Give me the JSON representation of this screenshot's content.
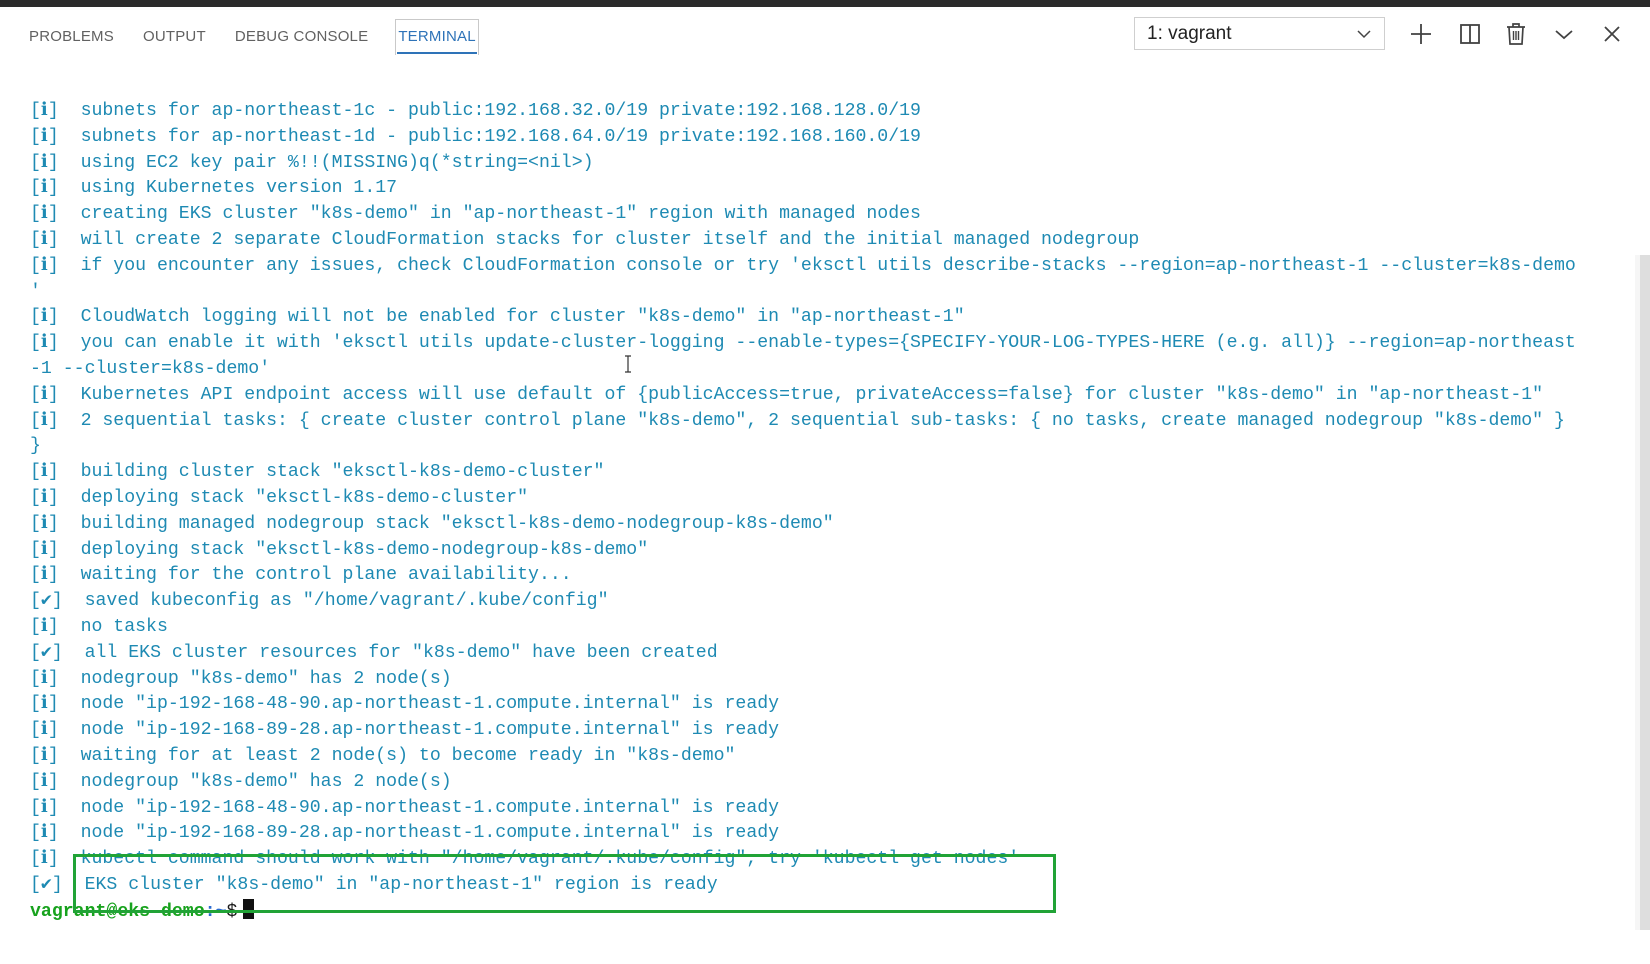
{
  "panel": {
    "tabs": [
      {
        "label": "PROBLEMS",
        "active": false
      },
      {
        "label": "OUTPUT",
        "active": false
      },
      {
        "label": "DEBUG CONSOLE",
        "active": false
      },
      {
        "label": "TERMINAL",
        "active": true
      }
    ],
    "terminal_selector": {
      "value": "1: vagrant"
    },
    "actions": [
      "plus-icon",
      "split-terminal-icon",
      "trash-icon",
      "chevron-down-icon",
      "close-icon"
    ]
  },
  "terminal": {
    "lines": [
      "[ℹ]  subnets for ap-northeast-1c - public:192.168.32.0/19 private:192.168.128.0/19",
      "[ℹ]  subnets for ap-northeast-1d - public:192.168.64.0/19 private:192.168.160.0/19",
      "[ℹ]  using EC2 key pair %!!(MISSING)q(*string=<nil>)",
      "[ℹ]  using Kubernetes version 1.17",
      "[ℹ]  creating EKS cluster \"k8s-demo\" in \"ap-northeast-1\" region with managed nodes",
      "[ℹ]  will create 2 separate CloudFormation stacks for cluster itself and the initial managed nodegroup",
      "[ℹ]  if you encounter any issues, check CloudFormation console or try 'eksctl utils describe-stacks --region=ap-northeast-1 --cluster=k8s-demo",
      "'",
      "[ℹ]  CloudWatch logging will not be enabled for cluster \"k8s-demo\" in \"ap-northeast-1\"",
      "[ℹ]  you can enable it with 'eksctl utils update-cluster-logging --enable-types={SPECIFY-YOUR-LOG-TYPES-HERE (e.g. all)} --region=ap-northeast",
      "-1 --cluster=k8s-demo'",
      "[ℹ]  Kubernetes API endpoint access will use default of {publicAccess=true, privateAccess=false} for cluster \"k8s-demo\" in \"ap-northeast-1\"",
      "[ℹ]  2 sequential tasks: { create cluster control plane \"k8s-demo\", 2 sequential sub-tasks: { no tasks, create managed nodegroup \"k8s-demo\" }",
      "}",
      "[ℹ]  building cluster stack \"eksctl-k8s-demo-cluster\"",
      "[ℹ]  deploying stack \"eksctl-k8s-demo-cluster\"",
      "[ℹ]  building managed nodegroup stack \"eksctl-k8s-demo-nodegroup-k8s-demo\"",
      "[ℹ]  deploying stack \"eksctl-k8s-demo-nodegroup-k8s-demo\"",
      "[ℹ]  waiting for the control plane availability...",
      "[✔]  saved kubeconfig as \"/home/vagrant/.kube/config\"",
      "[ℹ]  no tasks",
      "[✔]  all EKS cluster resources for \"k8s-demo\" have been created",
      "[ℹ]  nodegroup \"k8s-demo\" has 2 node(s)",
      "[ℹ]  node \"ip-192-168-48-90.ap-northeast-1.compute.internal\" is ready",
      "[ℹ]  node \"ip-192-168-89-28.ap-northeast-1.compute.internal\" is ready",
      "[ℹ]  waiting for at least 2 node(s) to become ready in \"k8s-demo\"",
      "[ℹ]  nodegroup \"k8s-demo\" has 2 node(s)",
      "[ℹ]  node \"ip-192-168-48-90.ap-northeast-1.compute.internal\" is ready",
      "[ℹ]  node \"ip-192-168-89-28.ap-northeast-1.compute.internal\" is ready",
      "[ℹ]  kubectl command should work with \"/home/vagrant/.kube/config\", try 'kubectl get nodes'",
      "[✔]  EKS cluster \"k8s-demo\" in \"ap-northeast-1\" region is ready"
    ],
    "prompt": {
      "user_host": "vagrant@eks-demo",
      "path": ":~",
      "symbol": "$"
    }
  },
  "colors": {
    "terminal_text": "#1e8ab3",
    "prompt_user": "#17a21d",
    "active_tab": "#2e73b8",
    "highlight_box": "#21a336"
  }
}
